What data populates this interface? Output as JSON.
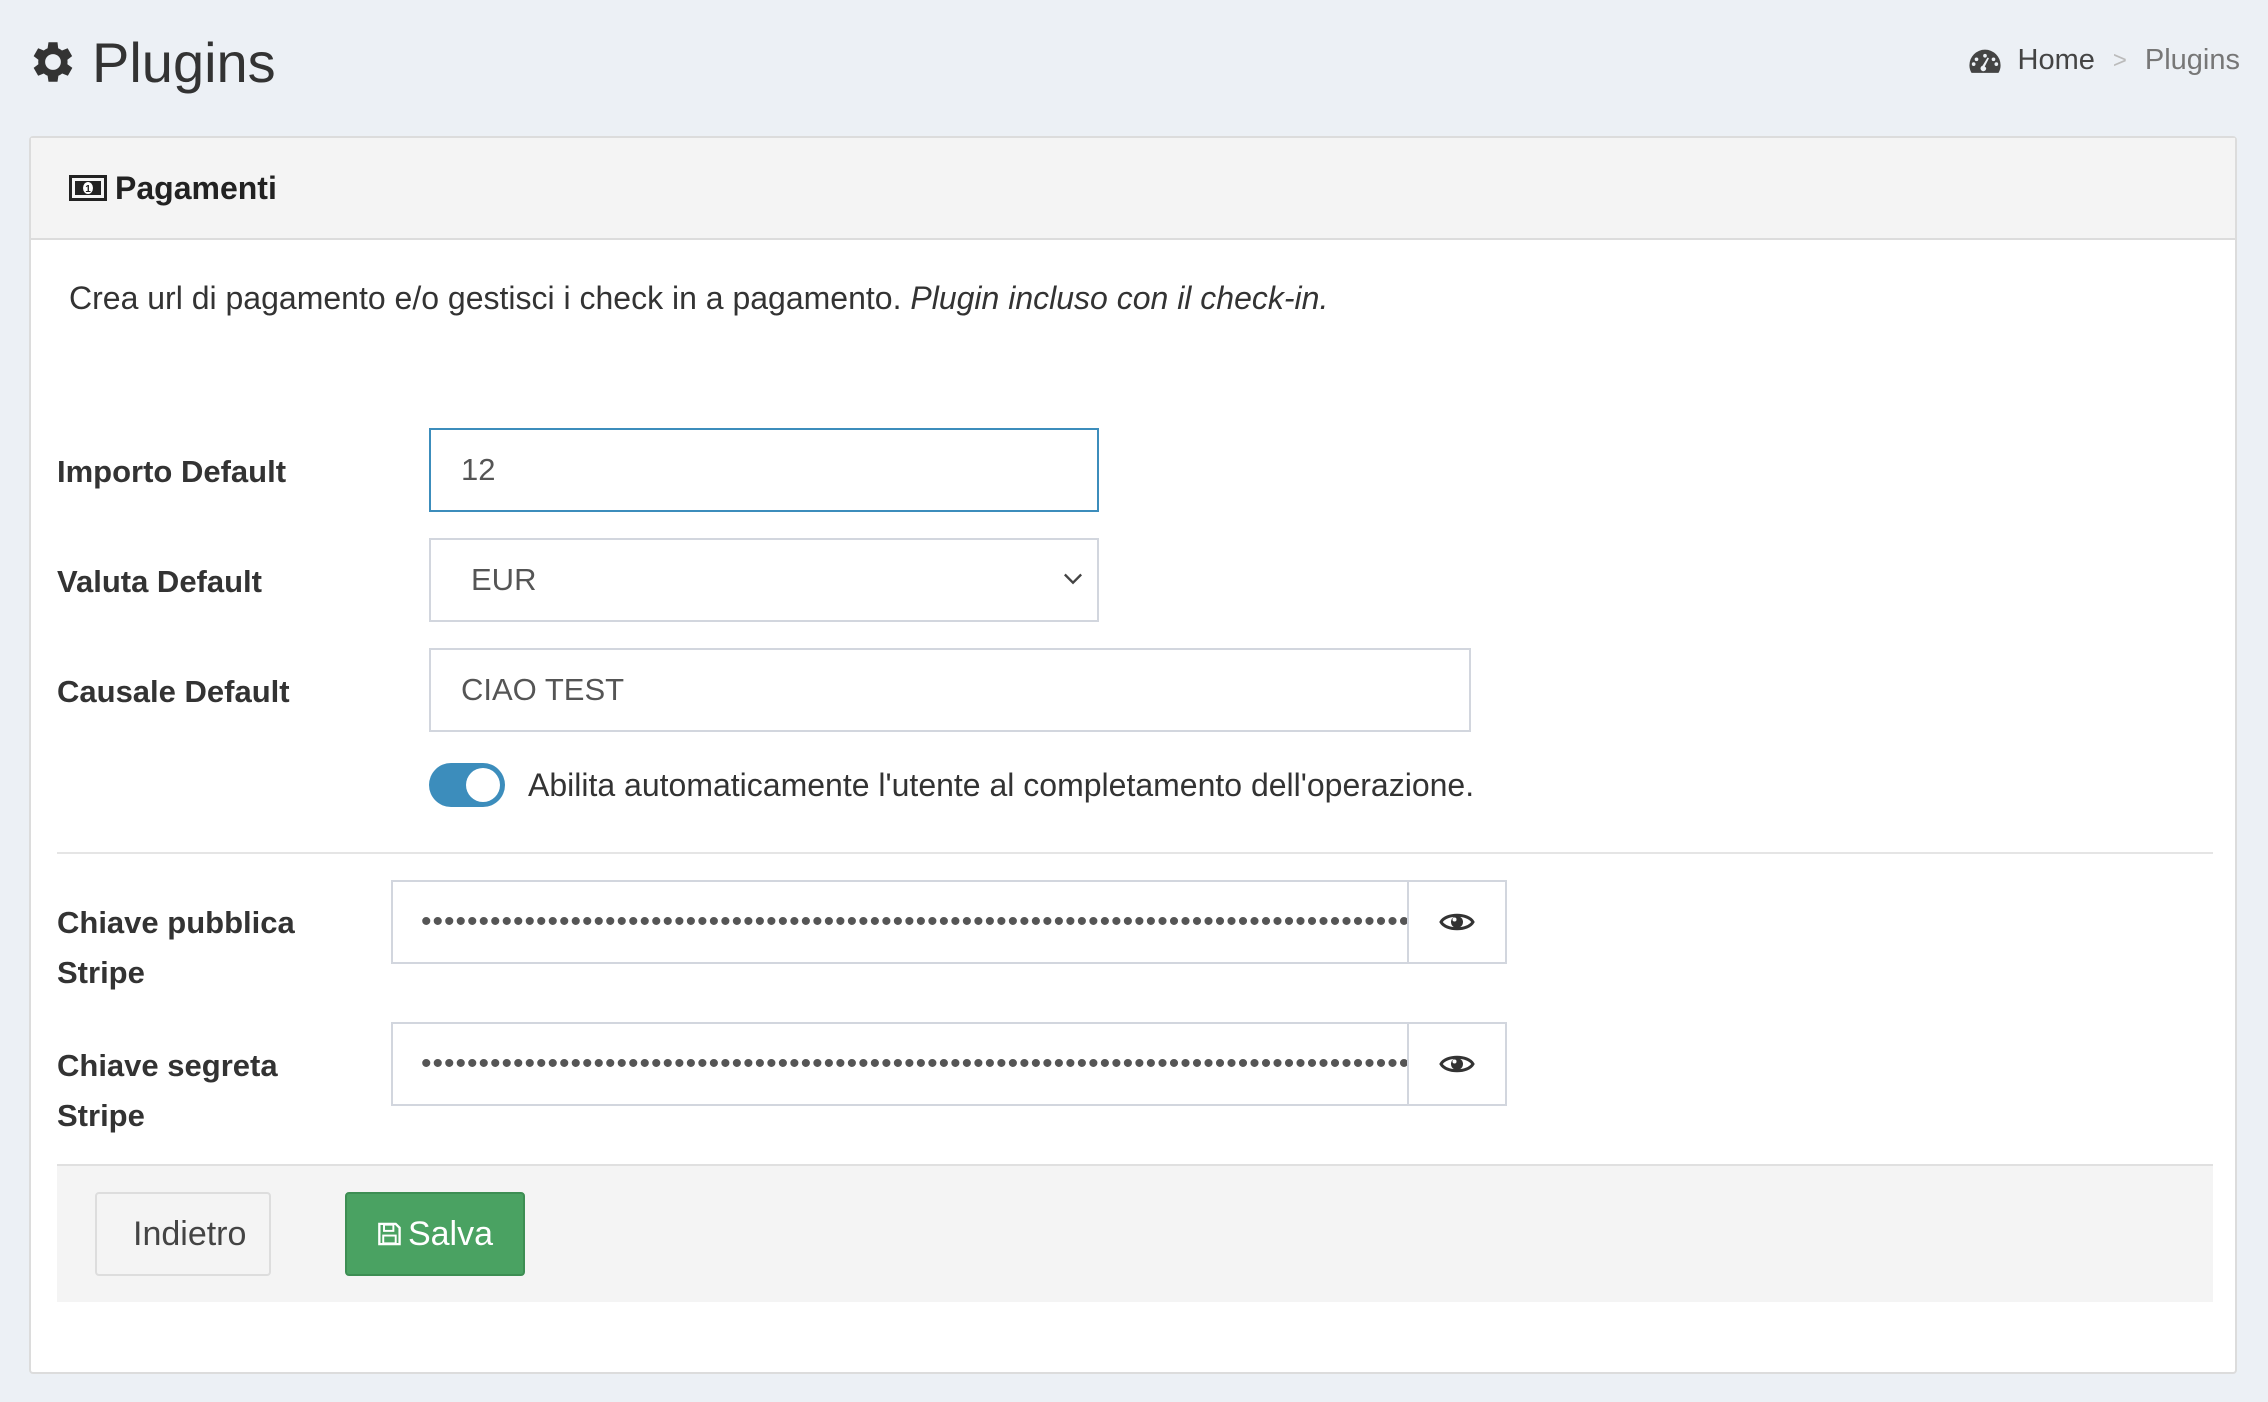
{
  "header": {
    "title": "Plugins",
    "title_icon": "gear-icon"
  },
  "breadcrumb": {
    "home_label": "Home",
    "home_icon": "dashboard-icon",
    "separator": ">",
    "current": "Plugins"
  },
  "box": {
    "title": "Pagamenti",
    "title_icon": "money-icon",
    "description": "Crea url di pagamento e/o gestisci i check in a pagamento.",
    "description_note": "Plugin incluso con il check-in."
  },
  "form": {
    "importo_label": "Importo Default",
    "importo_value": "12",
    "valuta_label": "Valuta Default",
    "valuta_value": "EUR",
    "causale_label": "Causale Default",
    "causale_value": "CIAO TEST",
    "auto_enable_label": "Abilita automaticamente l'utente al completamento dell'operazione.",
    "auto_enable_checked": true,
    "public_key_label_line1": "Chiave pubblica",
    "public_key_label_line2": "Stripe",
    "public_key_masked": "••••••••••••••••••••••••••••••••••••••••••••••••••••••••••••••••••••••••••••••••••••••••••••••••••••••••••",
    "secret_key_label_line1": "Chiave segreta",
    "secret_key_label_line2": "Stripe",
    "secret_key_masked": "••••••••••••••••••••••••••••••••••••••••••••••••••••••••••••••••••••••••••••••••••••••••••••••••••••••••••"
  },
  "actions": {
    "back_label": "Indietro",
    "back_icon": "chevron-circle-left-icon",
    "save_label": "Salva",
    "save_icon": "floppy-disk-icon"
  },
  "colors": {
    "primary": "#3c8dbc",
    "success": "#4aa262",
    "background": "#ecf0f5"
  }
}
